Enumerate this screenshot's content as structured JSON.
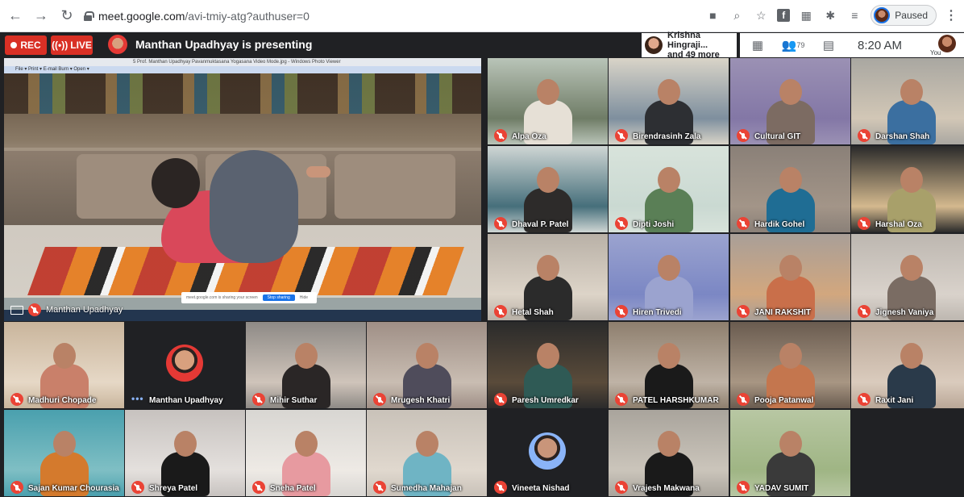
{
  "browser": {
    "url_host": "meet.google.com",
    "url_path": "/avi-tmiy-atg?authuser=0",
    "profile_status": "Paused"
  },
  "meet": {
    "rec_label": "REC",
    "live_label": "LIVE",
    "presenting_text": "Manthan Upadhyay is presenting",
    "people_chip_line1": "Krishna Hingraji...",
    "people_chip_line2": "and 49 more",
    "participant_count": "79",
    "time": "8:20 AM",
    "self_label": "You"
  },
  "presentation": {
    "window_title": "5 Prof. Manthan Upadhyay  Pavanmuktasana Yogasana Video Mode.jpg - Windows Photo Viewer",
    "menu": "File ▾   Print ▾   E-mail   Burn ▾   Open ▾",
    "share_text": "meet.google.com is sharing your screen",
    "stop_sharing": "Stop sharing",
    "hide": "Hide",
    "presenter_name": "Manthan Upadhyay"
  },
  "tiles": [
    {
      "name": "Alpa Oza",
      "muted": true
    },
    {
      "name": "Birendrasinh Zala",
      "muted": true
    },
    {
      "name": "Cultural GIT",
      "muted": true
    },
    {
      "name": "Darshan Shah",
      "muted": true
    },
    {
      "name": "Dhaval P. Patel",
      "muted": true
    },
    {
      "name": "Dipti Joshi",
      "muted": true
    },
    {
      "name": "Hardik Gohel",
      "muted": true
    },
    {
      "name": "Harshal Oza",
      "muted": true
    },
    {
      "name": "Hetal Shah",
      "muted": true
    },
    {
      "name": "Hiren Trivedi",
      "muted": true
    },
    {
      "name": "JANI RAKSHIT",
      "muted": true
    },
    {
      "name": "Jignesh Vaniya",
      "muted": true
    },
    {
      "name": "Madhuri Chopade",
      "muted": true
    },
    {
      "name": "Manthan Upadhyay",
      "muted": false
    },
    {
      "name": "Mihir Suthar",
      "muted": true
    },
    {
      "name": "Mrugesh Khatri",
      "muted": true
    },
    {
      "name": "Paresh Umredkar",
      "muted": true
    },
    {
      "name": "PATEL HARSHKUMAR",
      "muted": true
    },
    {
      "name": "Pooja Patanwal",
      "muted": true
    },
    {
      "name": "Raxit Jani",
      "muted": true
    },
    {
      "name": "Sajan Kumar Chourasia",
      "muted": true
    },
    {
      "name": "Shreya Patel",
      "muted": true
    },
    {
      "name": "Sneha Patel",
      "muted": true
    },
    {
      "name": "Sumedha Mahajan",
      "muted": true
    },
    {
      "name": "Vineeta Nishad",
      "muted": true
    },
    {
      "name": "Vrajesh Makwana",
      "muted": true
    },
    {
      "name": "YADAV SUMIT",
      "muted": true
    }
  ]
}
